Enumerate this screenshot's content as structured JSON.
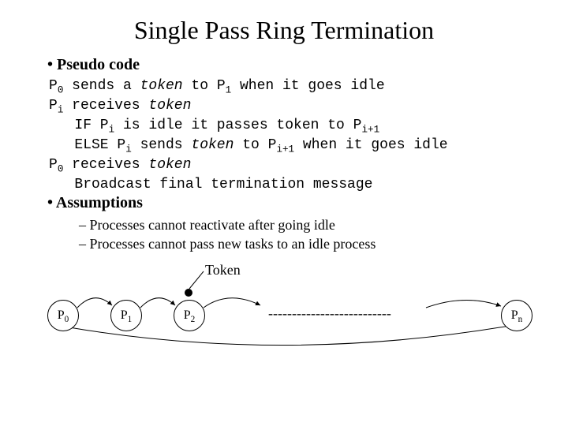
{
  "title": "Single Pass Ring Termination",
  "section1": "Pseudo code",
  "code": {
    "l1a": "P",
    "l1b": " sends a ",
    "l1c": "token",
    "l1d": " to P",
    "l1e": " when it goes idle",
    "l2a": "P",
    "l2b": " receives ",
    "l2c": "token",
    "l3a": "   IF P",
    "l3b": " is idle it passes token to P",
    "l4a": "   ELSE P",
    "l4b": " sends ",
    "l4c": "token",
    "l4d": " to P",
    "l4e": " when it goes idle",
    "l5a": "P",
    "l5b": " receives ",
    "l5c": "token",
    "l6": "   Broadcast final termination message",
    "s0": "0",
    "s1": "1",
    "si": "i",
    "sip1": "i+1"
  },
  "section2": "Assumptions",
  "assumptions": [
    "Processes cannot reactivate after going idle",
    "Processes cannot pass new tasks to an idle process"
  ],
  "diagram": {
    "token": "Token",
    "p0": "P",
    "p0s": "0",
    "p1": "P",
    "p1s": "1",
    "p2": "P",
    "p2s": "2",
    "pn": "P",
    "pns": "n",
    "dots": "--------------------------"
  }
}
